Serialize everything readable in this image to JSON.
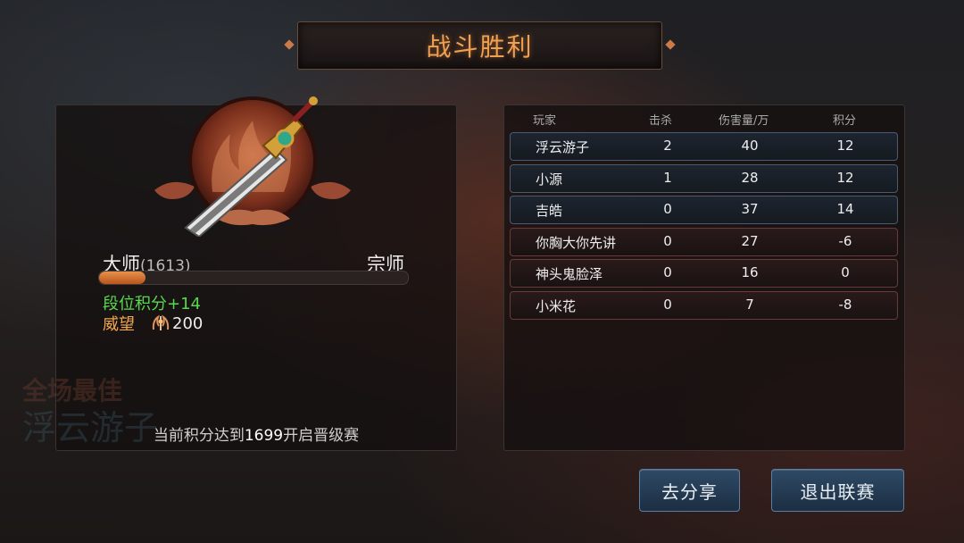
{
  "title": "战斗胜利",
  "rank": {
    "current": "大师",
    "points": "(1613)",
    "next": "宗师",
    "progress_fraction": 0.15,
    "gain": "段位积分+14",
    "prestige_label": "威望",
    "prestige_value": "200",
    "mvp_label": "全场最佳",
    "mvp_name": "浮云游子",
    "promo_prefix": "当前积分达到",
    "promo_target": "1699",
    "promo_suffix": "开启晋级赛"
  },
  "table": {
    "headers": {
      "player": "玩家",
      "kills": "击杀",
      "damage": "伤害量/万",
      "score": "积分"
    },
    "rows": [
      {
        "name": "浮云游子",
        "kills": "2",
        "damage": "40",
        "score": "12",
        "team": "blue"
      },
      {
        "name": "小源",
        "kills": "1",
        "damage": "28",
        "score": "12",
        "team": "blue"
      },
      {
        "name": "吉皓",
        "kills": "0",
        "damage": "37",
        "score": "14",
        "team": "blue"
      },
      {
        "name": "你胸大你先讲",
        "kills": "0",
        "damage": "27",
        "score": "-6",
        "team": "red"
      },
      {
        "name": "神头鬼脸泽",
        "kills": "0",
        "damage": "16",
        "score": "0",
        "team": "red"
      },
      {
        "name": "小米花",
        "kills": "0",
        "damage": "7",
        "score": "-8",
        "team": "red"
      }
    ]
  },
  "buttons": {
    "share": "去分享",
    "exit": "退出联赛"
  },
  "colors": {
    "title": "#f0a050",
    "gain": "#58d84e",
    "prestige": "#f0a84a",
    "button": "#2e4a66"
  }
}
